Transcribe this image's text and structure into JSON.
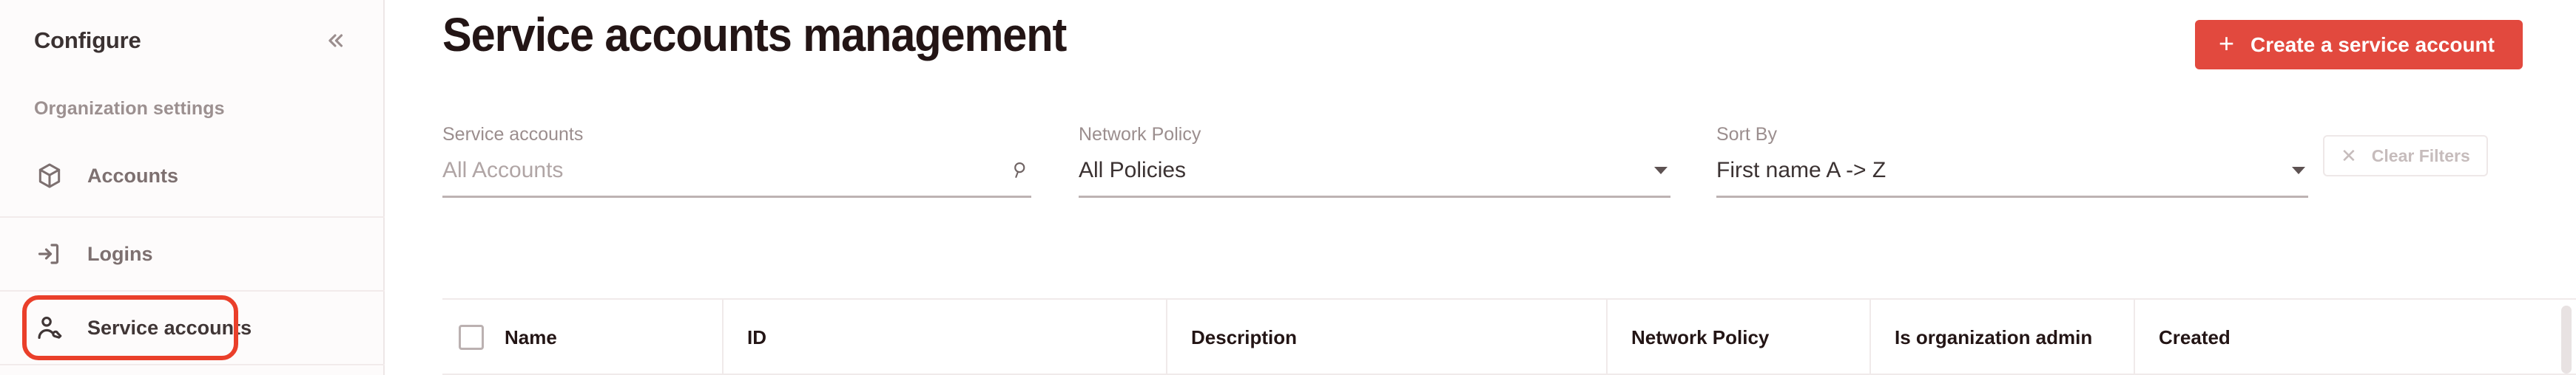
{
  "sidebar": {
    "title": "Configure",
    "collapse_icon": "chevron-double-left-icon",
    "section_label": "Organization settings",
    "items": [
      {
        "label": "Accounts",
        "icon": "cube-icon",
        "active": false
      },
      {
        "label": "Logins",
        "icon": "login-arrow-icon",
        "active": false
      },
      {
        "label": "Service accounts",
        "icon": "user-wrench-icon",
        "active": true
      }
    ],
    "highlight_color": "#ea3f2a"
  },
  "header": {
    "title": "Service accounts management",
    "create_button": {
      "label": "Create a service account",
      "icon": "plus-icon",
      "color": "#e2493e"
    }
  },
  "filters": {
    "search": {
      "label": "Service accounts",
      "placeholder": "All Accounts",
      "value": "",
      "icon": "search-icon"
    },
    "network_policy": {
      "label": "Network Policy",
      "value": "All Policies",
      "icon": "chevron-down-icon"
    },
    "sort_by": {
      "label": "Sort By",
      "value": "First name A -> Z",
      "icon": "chevron-down-icon"
    },
    "clear_filters": {
      "label": "Clear Filters",
      "icon": "close-x-icon"
    }
  },
  "table": {
    "select_all_checked": false,
    "columns": [
      "Name",
      "ID",
      "Description",
      "Network Policy",
      "Is organization admin",
      "Created"
    ],
    "rows": []
  }
}
